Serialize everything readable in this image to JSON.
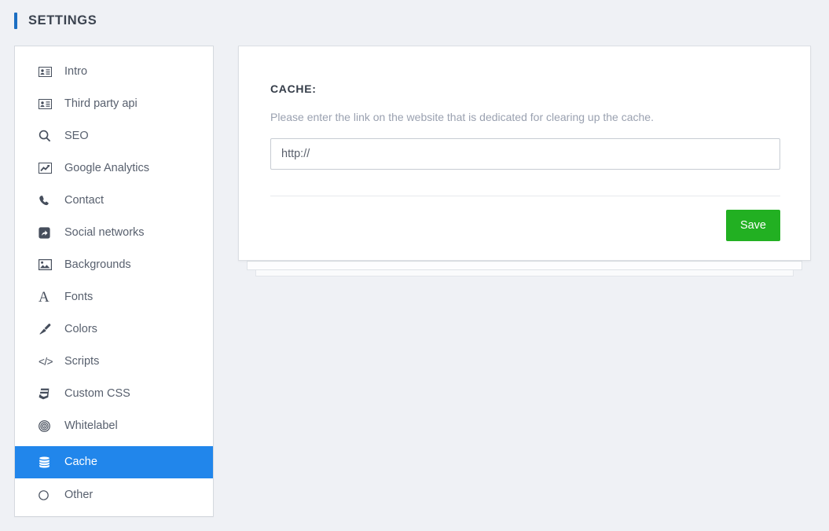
{
  "header": {
    "title": "SETTINGS",
    "accent_color": "#1b6ec2"
  },
  "sidebar": {
    "active_color": "#2186eb",
    "items": [
      {
        "label": "Intro",
        "icon": "contact-card-icon",
        "active": false
      },
      {
        "label": "Third party api",
        "icon": "contact-card-icon",
        "active": false
      },
      {
        "label": "SEO",
        "icon": "search-icon",
        "active": false
      },
      {
        "label": "Google Analytics",
        "icon": "chart-line-icon",
        "active": false
      },
      {
        "label": "Contact",
        "icon": "phone-icon",
        "active": false
      },
      {
        "label": "Social networks",
        "icon": "share-icon",
        "active": false
      },
      {
        "label": "Backgrounds",
        "icon": "image-icon",
        "active": false
      },
      {
        "label": "Fonts",
        "icon": "letter-a-icon",
        "active": false
      },
      {
        "label": "Colors",
        "icon": "brush-icon",
        "active": false
      },
      {
        "label": "Scripts",
        "icon": "code-icon",
        "active": false
      },
      {
        "label": "Custom CSS",
        "icon": "css3-icon",
        "active": false
      },
      {
        "label": "Whitelabel",
        "icon": "bullseye-icon",
        "active": false
      },
      {
        "label": "Cache",
        "icon": "database-icon",
        "active": true
      },
      {
        "label": "Other",
        "icon": "circle-icon",
        "active": false
      }
    ]
  },
  "main": {
    "section_title": "CACHE:",
    "description": "Please enter the link on the website that is dedicated for clearing up the cache.",
    "cache_url": {
      "value": "http://",
      "placeholder": "http://"
    },
    "save_label": "Save",
    "save_color": "#22b022"
  }
}
